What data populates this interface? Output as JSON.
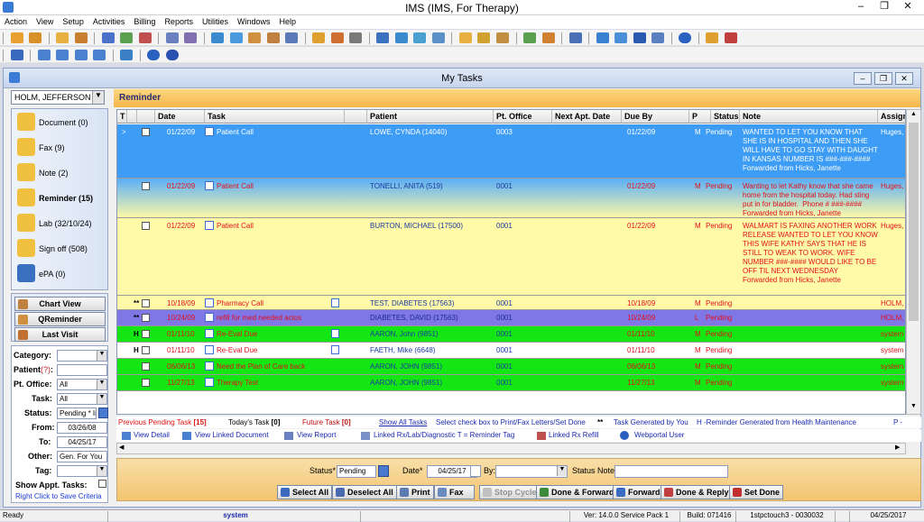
{
  "app": {
    "title": "IMS (IMS, For Therapy)"
  },
  "menu": [
    "Action",
    "View",
    "Setup",
    "Activities",
    "Billing",
    "Reports",
    "Utilities",
    "Windows",
    "Help"
  ],
  "window": {
    "title": "My Tasks"
  },
  "patient_select": "HOLM, JEFFERSON",
  "section_title": "Reminder",
  "nav": [
    {
      "label": "Document (0)",
      "icon": "document-folder-icon",
      "bold": false
    },
    {
      "label": "Fax (9)",
      "icon": "fax-folder-icon",
      "bold": false
    },
    {
      "label": "Note (2)",
      "icon": "note-folder-icon",
      "bold": false
    },
    {
      "label": "Reminder (15)",
      "icon": "reminder-folder-icon",
      "bold": true
    },
    {
      "label": "Lab (32/10/24)",
      "icon": "lab-folder-icon",
      "bold": false
    },
    {
      "label": "Sign off (508)",
      "icon": "signoff-folder-icon",
      "bold": false
    },
    {
      "label": "ePA (0)",
      "icon": "epa-icon",
      "bold": false
    }
  ],
  "nav_buttons": {
    "chart_view": "Chart View",
    "qreminder": "QReminder",
    "last_visit": "Last Visit"
  },
  "filters": {
    "category_label": "Category:",
    "category_value": "",
    "patient_label": "Patient",
    "patient_help": "(?)",
    "patient_suffix": ":",
    "office_label": "Pt. Office:",
    "office_value": "All",
    "task_label": "Task:",
    "task_value": "All",
    "status_label": "Status:",
    "status_value": "Pending * In",
    "from_label": "From:",
    "from_value": "03/26/08",
    "to_label": "To:",
    "to_value": "04/25/17",
    "other_label": "Other:",
    "other_value": "Gen. For You",
    "tag_label": "Tag:",
    "tag_value": "",
    "show_appt_label": "Show Appt. Tasks:",
    "save_hint": "Right Click to Save Criteria"
  },
  "grid": {
    "columns": [
      "T",
      "",
      "",
      "Date",
      "Task",
      "",
      "Patient",
      "Pt. Office",
      "Next Apt. Date",
      "Due By",
      "P",
      "Status",
      "Note",
      "Assign"
    ],
    "rows": [
      {
        "pointer": ">",
        "flag": "",
        "date": "01/22/09",
        "task": "Patient Call",
        "patient": "LOWE, CYNDA  (14040)",
        "office": "0003",
        "next_apt": "",
        "due": "01/22/09",
        "p": "M",
        "status": "Pending",
        "note": "WANTED TO LET YOU KNOW THAT SHE IS IN HOSPITAL AND THEN SHE WILL HAVE TO GO STAY WITH DAUGHT IN KANSAS NUMBER IS ###-###-####\nForwarded from Hicks, Janette",
        "assign": "Huges, R",
        "bg": "#3d9cf5",
        "color": "#ffffff",
        "accent": "#ffffff",
        "has_pat_icon": false
      },
      {
        "pointer": "",
        "flag": "",
        "date": "01/22/09",
        "task": "Patient Call",
        "patient": "TONELLI, ANITA  (519)",
        "office": "0001",
        "next_apt": "",
        "due": "01/22/09",
        "p": "M",
        "status": "Pending",
        "note": "Wanting to let Kathy know that she came home from the hospital today. Had sling put in for bladder.  Phone # ###-####\nForwarded from Hicks, Janette",
        "assign": "Huges, R",
        "bg": "grad",
        "color": "#1a3aa0",
        "accent": "#e0101a",
        "has_pat_icon": false
      },
      {
        "pointer": "",
        "flag": "",
        "date": "01/22/09",
        "task": "Patient Call",
        "patient": "BURTON, MICHAEL  (17500)",
        "office": "0001",
        "next_apt": "",
        "due": "01/22/09",
        "p": "M",
        "status": "Pending",
        "note": "WALMART IS FAXING ANOTHER WORK RELEASE WANTED TO LET YOU KNOW THIS WIFE KATHY SAYS THAT HE IS STILL TO WEAK TO WORK. WIFE NUMBER ###-#### WOULD LIKE TO BE OFF TIL NEXT WEDNESDAY\nForwarded from Hicks, Janette",
        "assign": "Huges, R",
        "bg": "#fffaa8",
        "color": "#1a3aa0",
        "accent": "#e0101a",
        "has_pat_icon": false
      },
      {
        "pointer": "",
        "flag": "**",
        "date": "10/18/09",
        "task": "Pharmacy Call",
        "patient": "TEST, DIABETES  (17563)",
        "office": "0001",
        "next_apt": "",
        "due": "10/18/09",
        "p": "M",
        "status": "Pending",
        "note": "",
        "assign": "HOLM, JE",
        "bg": "#fffaa8",
        "color": "#1a3aa0",
        "accent": "#e0101a",
        "has_pat_icon": true
      },
      {
        "pointer": "",
        "flag": "**",
        "date": "10/24/09",
        "task": "refill for med needed actos",
        "patient": "DIABETES, DAVID  (17563)",
        "office": "0001",
        "next_apt": "",
        "due": "10/24/09",
        "p": "L",
        "status": "Pending",
        "note": "",
        "assign": "HOLM, JE",
        "bg": "#8077e6",
        "color": "#1a2a90",
        "accent": "#e0101a",
        "has_pat_icon": false
      },
      {
        "pointer": "",
        "flag": "H",
        "date": "01/11/10",
        "task": "Re-Eval Due",
        "patient": "AARON, John  (9851)",
        "office": "0001",
        "next_apt": "",
        "due": "01/11/10",
        "p": "M",
        "status": "Pending",
        "note": "",
        "assign": "system",
        "bg": "#14e614",
        "color": "#1a3aa0",
        "accent": "#e0101a",
        "has_pat_icon": true
      },
      {
        "pointer": "",
        "flag": "H",
        "date": "01/11/10",
        "task": "Re-Eval Due",
        "patient": "FAETH, Mike  (6648)",
        "office": "0001",
        "next_apt": "",
        "due": "01/11/10",
        "p": "M",
        "status": "Pending",
        "note": "",
        "assign": "system",
        "bg": "#ffffff",
        "color": "#1a3aa0",
        "accent": "#e0101a",
        "has_pat_icon": true
      },
      {
        "pointer": "",
        "flag": "",
        "date": "06/06/13",
        "task": "Need the Plan of Care back",
        "patient": "AARON, JOHN  (9851)",
        "office": "0001",
        "next_apt": "",
        "due": "06/06/13",
        "p": "M",
        "status": "Pending",
        "note": "",
        "assign": "system",
        "bg": "#14e614",
        "color": "#1a3aa0",
        "accent": "#e0101a",
        "has_pat_icon": false
      },
      {
        "pointer": "",
        "flag": "",
        "date": "11/27/13",
        "task": "Therapy Test",
        "patient": "AARON, JOHN  (9851)",
        "office": "0001",
        "next_apt": "",
        "due": "11/27/13",
        "p": "M",
        "status": "Pending",
        "note": "",
        "assign": "system",
        "bg": "#14e614",
        "color": "#1a3aa0",
        "accent": "#e0101a",
        "has_pat_icon": false
      }
    ]
  },
  "legend1": {
    "prev": "Previous Pending Task",
    "prev_n": "[15]",
    "today": "Today's Task",
    "today_n": "[0]",
    "future": "Future Task",
    "future_n": "[0]",
    "show_all": "Show All Tasks",
    "hint": "Select check box to Print/Fax Letters/Set Done",
    "gen_mark": "**",
    "gen": "Task Generated by You",
    "hm": "H -Reminder Generated from Health Maintenance",
    "p": "P -"
  },
  "legend2": {
    "view_detail": "View Detail",
    "view_linked": "View Linked Document",
    "view_report": "View Report",
    "linked_rx": "Linked Rx/Lab/Diagnostic  T = Reminder Tag",
    "linked_refill": "Linked Rx Refill",
    "webportal": "Webportal User"
  },
  "actions": {
    "status_label": "Status*",
    "status_value": "Pending",
    "date_label": "Date*",
    "date_value": "04/25/17",
    "by_label": "By:",
    "by_value": "",
    "note_label": "Status Note:",
    "note_value": "",
    "buttons": [
      "Select All",
      "Deselect All",
      "Print",
      "Fax",
      "Stop Cycle",
      "Done & Forward",
      "Forward",
      "Done & Reply",
      "Set Done"
    ]
  },
  "status": {
    "ready": "Ready",
    "user": "system",
    "version": "Ver: 14.0.0 Service Pack 1",
    "build": "Build: 071416",
    "station": "1stpctouch3 - 0030032",
    "date": "04/25/2017"
  }
}
